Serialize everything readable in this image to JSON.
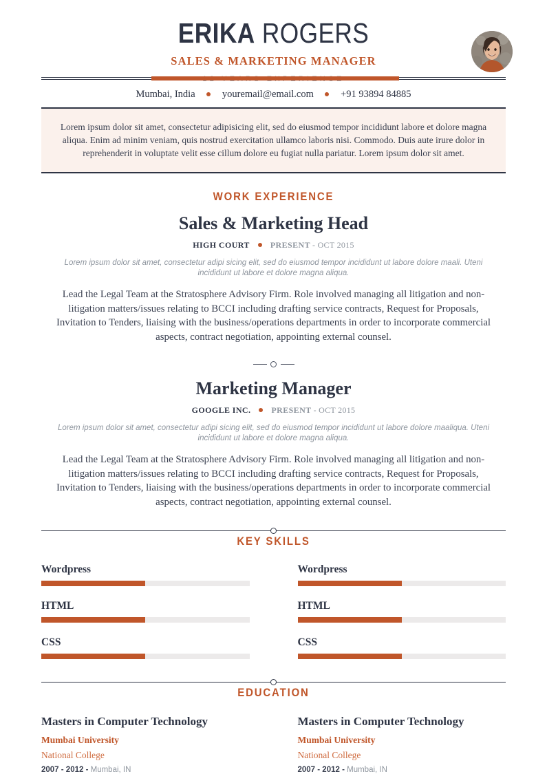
{
  "header": {
    "first_name": "ERIKA",
    "last_name": " ROGERS",
    "job_title": "SALES & MARKETING MANAGER",
    "experience": "12 YEARS EXPERIENCE",
    "avatar_alt": "profile-photo"
  },
  "contact": {
    "location": "Mumbai, India",
    "email": "youremail@email.com",
    "phone": "+91 93894 84885"
  },
  "summary": {
    "text": "Lorem ipsum dolor sit amet, consectetur adipisicing elit, sed do eiusmod tempor incididunt labore et dolore magna aliqua. Enim ad minim veniam, quis nostrud exercitation ullamco laboris nisi. Commodo. Duis aute irure dolor in reprehenderit in voluptate velit esse cillum dolore eu fugiat nulla pariatur. Lorem ipsum dolor sit amet."
  },
  "work": {
    "section_title": "WORK EXPERIENCE",
    "jobs": [
      {
        "role": "Sales & Marketing Head",
        "company": "HIGH COURT",
        "present": "PRESENT",
        "dates": "- OCT 2015",
        "tagline": "Lorem ipsum dolor sit amet, consectetur adipi sicing elit, sed do eiusmod tempor incididunt ut labore dolore maali. Uteni incididunt ut labore et dolore magna aliqua.",
        "description": "Lead the Legal Team at the Stratosphere Advisory Firm. Role involved managing all litigation and non-litigation matters/issues relating to BCCI including drafting service contracts, Request for Proposals, Invitation to Tenders, liaising with the business/operations departments in order to incorporate commercial aspects, contract negotiation, appointing external counsel."
      },
      {
        "role": "Marketing Manager",
        "company": "GOOGLE INC.",
        "present": "PRESENT",
        "dates": "- OCT 2015",
        "tagline": "Lorem ipsum dolor sit amet, consectetur adipi sicing elit, sed do eiusmod tempor incididunt ut labore dolore maaliqua. Uteni incididunt ut labore et dolore magna aliqua.",
        "description": "Lead the Legal Team at the Stratosphere Advisory Firm. Role involved managing all litigation and non-litigation matters/issues relating to BCCI including drafting service contracts, Request for Proposals, Invitation to Tenders, liaising with the business/operations departments in order to incorporate commercial aspects, contract negotiation, appointing external counsel."
      }
    ]
  },
  "skills": {
    "section_title": "KEY SKILLS",
    "left": [
      {
        "name": "Wordpress",
        "level": "50%"
      },
      {
        "name": "HTML",
        "level": "50%"
      },
      {
        "name": "CSS",
        "level": "50%"
      }
    ],
    "right": [
      {
        "name": "Wordpress",
        "level": "50%"
      },
      {
        "name": "HTML",
        "level": "50%"
      },
      {
        "name": "CSS",
        "level": "50%"
      }
    ]
  },
  "education": {
    "section_title": "EDUCATION",
    "entries": [
      {
        "degree": "Masters in Computer Technology",
        "university": "Mumbai University",
        "college": "National College",
        "years": "2007 - 2012 -",
        "location": " Mumbai, IN"
      },
      {
        "degree": "Masters in Computer Technology",
        "university": "Mumbai University",
        "college": "National College",
        "years": "2007 - 2012 -",
        "location": " Mumbai, IN"
      }
    ]
  },
  "colors": {
    "accent": "#c0562a",
    "accent_light": "#cf6b3f",
    "dark": "#2e3444",
    "muted": "#8e959e",
    "summary_bg": "#fbf1ec",
    "track": "#eceaea"
  }
}
